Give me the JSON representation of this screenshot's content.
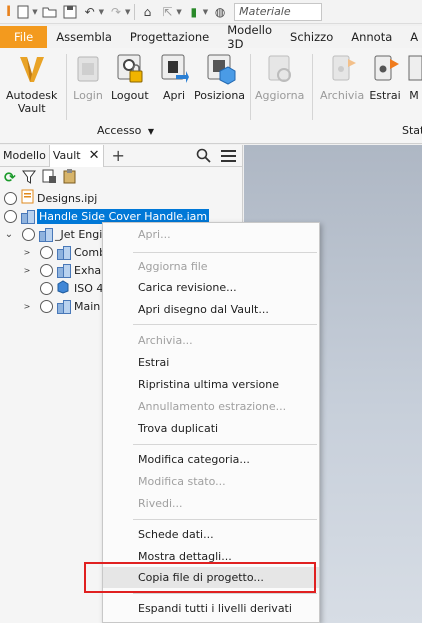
{
  "qat": {
    "material_placeholder": "Materiale"
  },
  "tabs": [
    "File",
    "Assembla",
    "Progettazione",
    "Modello 3D",
    "Schizzo",
    "Annota",
    "A"
  ],
  "ribbon": {
    "vault": {
      "line1": "Autodesk",
      "line2": "Vault"
    },
    "buttons": {
      "login": "Login",
      "logout": "Logout",
      "apri": "Apri",
      "posizione": "Posiziona",
      "aggiorna": "Aggiorna",
      "archivia": "Archivia",
      "estrai": "Estrai",
      "more": "M"
    },
    "group_accesso": "Accesso",
    "group_stat": "Stat"
  },
  "panel": {
    "tab_modello": "Modello",
    "tab_vault": "Vault",
    "tree": {
      "designs": "Designs.ipj",
      "handle": "Handle Side Cover Handle.iam",
      "jet": "_Jet Engi",
      "comb": "Comb",
      "exha": "Exha",
      "iso": "ISO 4",
      "main": "Main"
    }
  },
  "menu": {
    "apri": "Apri...",
    "aggiorna_file": "Aggiorna file",
    "carica_revisione": "Carica revisione...",
    "apri_disegno": "Apri disegno dal Vault...",
    "archivia": "Archivia...",
    "estrai": "Estrai",
    "ripristina": "Ripristina ultima versione",
    "annullamento": "Annullamento estrazione...",
    "trova_duplicati": "Trova duplicati",
    "modifica_categoria": "Modifica categoria...",
    "modifica_stato": "Modifica stato...",
    "rivedi": "Rivedi...",
    "schede_dati": "Schede dati...",
    "mostra_dettagli": "Mostra dettagli...",
    "copia_file": "Copia file di progetto...",
    "espandi": "Espandi tutti i livelli derivati"
  },
  "colors": {
    "file_tab": "#f39a1e",
    "selection": "#0078d7",
    "highlight_box": "#e02020"
  }
}
